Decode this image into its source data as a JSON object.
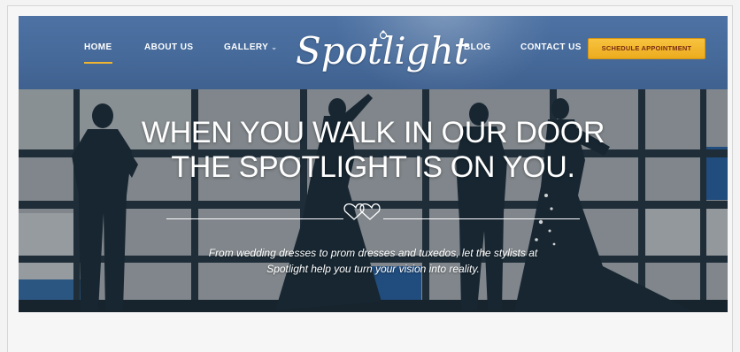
{
  "nav": {
    "items": [
      {
        "label": "HOME",
        "active": true
      },
      {
        "label": "ABOUT US",
        "active": false
      },
      {
        "label": "GALLERY",
        "active": false,
        "has_dropdown": true
      },
      {
        "label": "BLOG",
        "active": false
      },
      {
        "label": "CONTACT US",
        "active": false
      }
    ],
    "cta_label": "SCHEDULE APPOINTMENT"
  },
  "logo": {
    "text": "Spotlight",
    "icon": "diamond-ring-icon"
  },
  "hero": {
    "title_line1": "WHEN YOU WALK IN OUR DOOR",
    "title_line2": "THE SPOTLIGHT IS ON YOU.",
    "subtitle_line1": "From wedding dresses to prom dresses and tuxedos, let the stylists at",
    "subtitle_line2": "Spotlight help you turn your vision into reality.",
    "divider_icon": "double-heart-icon"
  },
  "colors": {
    "header_bg": "#466a9a",
    "accent": "#f0b430",
    "cta_bg": "#f4b82c",
    "cta_text": "#7a2d12"
  }
}
